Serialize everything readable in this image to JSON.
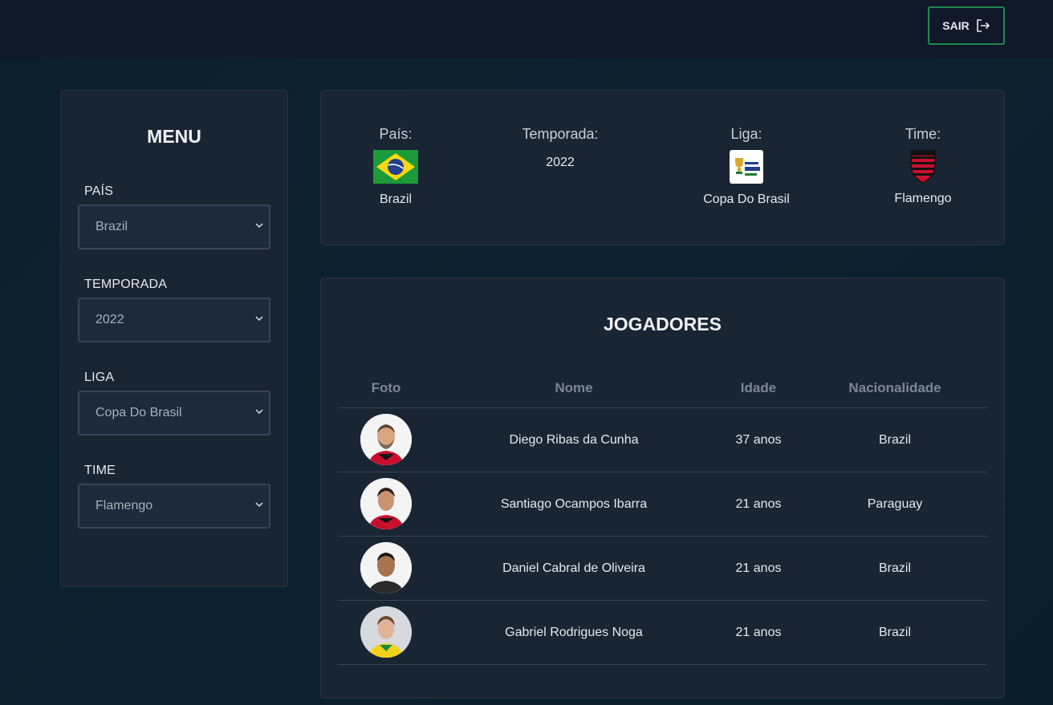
{
  "header": {
    "logout_label": "SAIR",
    "logout_icon": "logout-icon"
  },
  "menu": {
    "title": "MENU",
    "fields": [
      {
        "label": "PAÍS",
        "value": "Brazil"
      },
      {
        "label": "TEMPORADA",
        "value": "2022"
      },
      {
        "label": "LIGA",
        "value": "Copa Do Brasil"
      },
      {
        "label": "TIME",
        "value": "Flamengo"
      }
    ]
  },
  "info": {
    "country": {
      "label": "País:",
      "value": "Brazil",
      "icon": "brazil-flag-icon"
    },
    "season": {
      "label": "Temporada:",
      "value": "2022"
    },
    "league": {
      "label": "Liga:",
      "value": "Copa Do Brasil",
      "icon": "copa-do-brasil-logo"
    },
    "team": {
      "label": "Time:",
      "value": "Flamengo",
      "icon": "flamengo-crest"
    }
  },
  "players": {
    "title": "JOGADORES",
    "columns": [
      "Foto",
      "Nome",
      "Idade",
      "Nacionalidade"
    ],
    "rows": [
      {
        "name": "Diego Ribas da Cunha",
        "age": "37 anos",
        "nationality": "Brazil"
      },
      {
        "name": "Santiago Ocampos Ibarra",
        "age": "21 anos",
        "nationality": "Paraguay"
      },
      {
        "name": "Daniel Cabral de Oliveira",
        "age": "21 anos",
        "nationality": "Brazil"
      },
      {
        "name": "Gabriel Rodrigues Noga",
        "age": "21 anos",
        "nationality": "Brazil"
      }
    ]
  },
  "colors": {
    "accent_border": "#1f8a4c",
    "card_bg": "#1a2533",
    "page_bg": "#0a1c28"
  }
}
